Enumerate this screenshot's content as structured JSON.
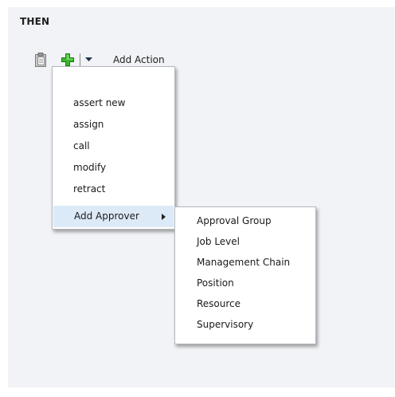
{
  "section": {
    "title": "THEN"
  },
  "toolbar": {
    "icons": {
      "paste": "clipboard-icon",
      "add": "plus-icon",
      "dropdown": "chevron-down-icon"
    },
    "add_action_label": "Add Action",
    "plus_color": "#33a62a"
  },
  "action_menu": {
    "items": [
      {
        "label": "assert new"
      },
      {
        "label": "assign"
      },
      {
        "label": "call"
      },
      {
        "label": "modify"
      },
      {
        "label": "retract"
      },
      {
        "label": "Add Approver",
        "has_submenu": true,
        "highlighted": true
      }
    ]
  },
  "approver_submenu": {
    "items": [
      {
        "label": "Approval Group"
      },
      {
        "label": "Job Level"
      },
      {
        "label": "Management Chain"
      },
      {
        "label": "Position"
      },
      {
        "label": "Resource"
      },
      {
        "label": "Supervisory"
      }
    ]
  },
  "colors": {
    "panel_background": "#f1f3f6",
    "highlight": "#dceaf8"
  }
}
